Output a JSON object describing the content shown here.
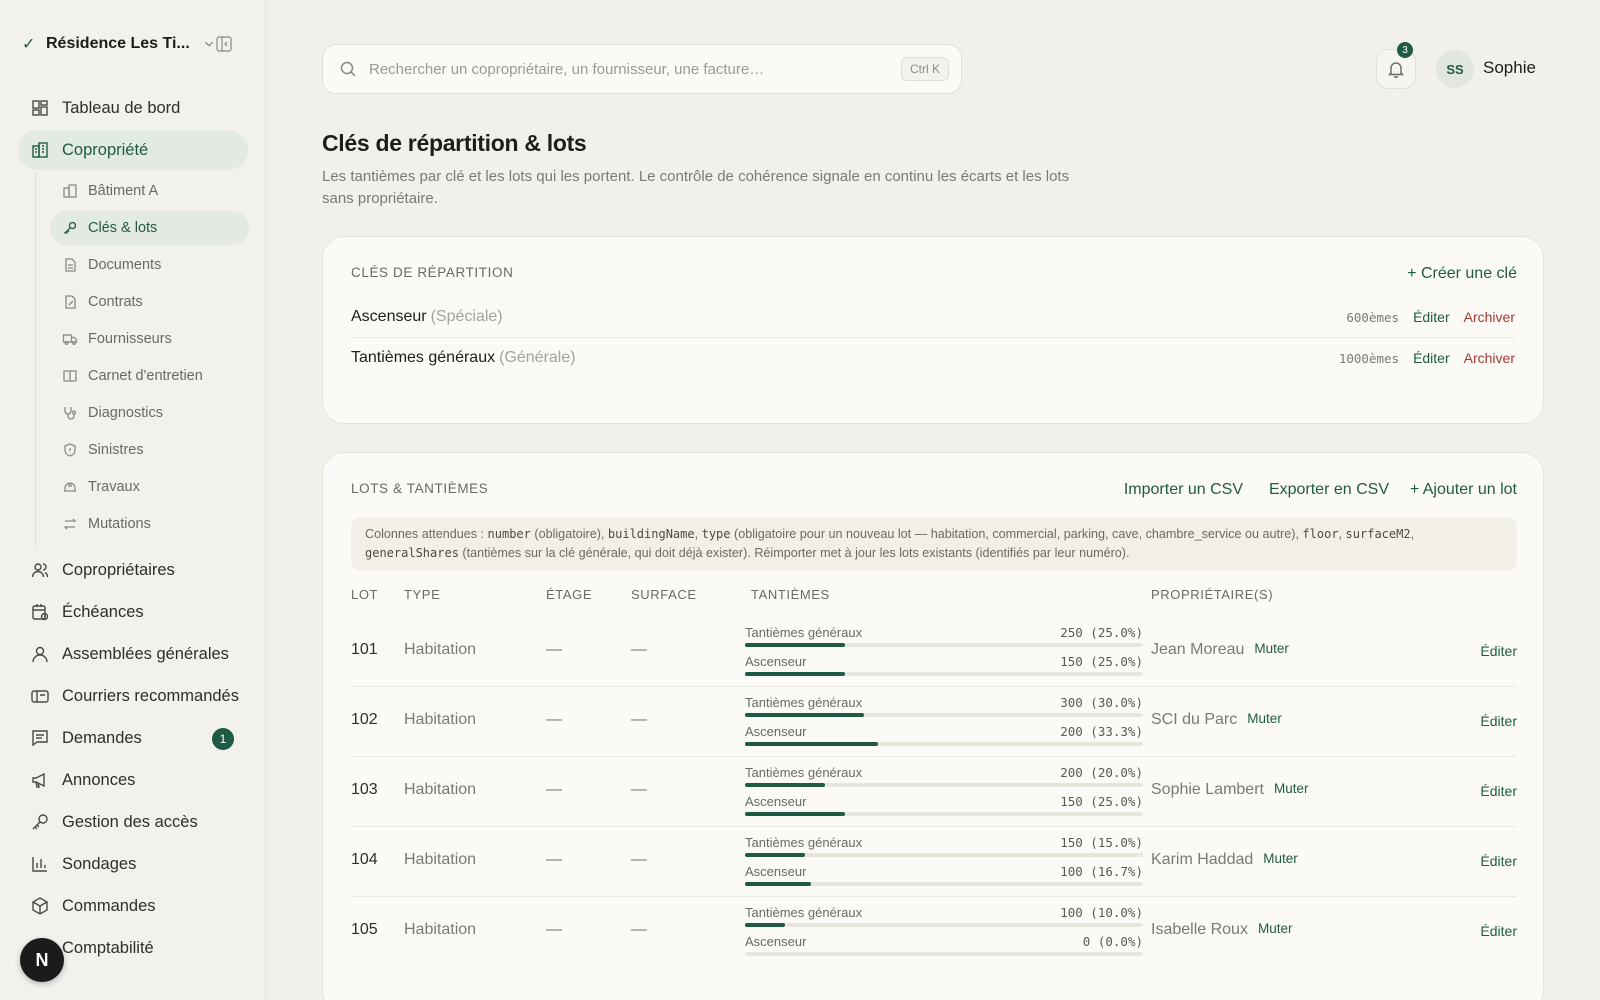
{
  "sidebar": {
    "org_name": "Résidence Les Ti...",
    "nav": [
      {
        "label": "Tableau de bord",
        "icon": "dashboard-icon"
      },
      {
        "label": "Copropriété",
        "icon": "building-icon",
        "active": true
      }
    ],
    "sub": [
      {
        "label": "Bâtiment A",
        "icon": "building-small-icon"
      },
      {
        "label": "Clés & lots",
        "icon": "key-icon",
        "active": true
      },
      {
        "label": "Documents",
        "icon": "document-icon"
      },
      {
        "label": "Contrats",
        "icon": "contract-icon"
      },
      {
        "label": "Fournisseurs",
        "icon": "truck-icon"
      },
      {
        "label": "Carnet d'entretien",
        "icon": "book-icon"
      },
      {
        "label": "Diagnostics",
        "icon": "stethoscope-icon"
      },
      {
        "label": "Sinistres",
        "icon": "shield-icon"
      },
      {
        "label": "Travaux",
        "icon": "hardhat-icon"
      },
      {
        "label": "Mutations",
        "icon": "swap-icon"
      }
    ],
    "nav2": [
      {
        "label": "Copropriétaires",
        "icon": "users-icon"
      },
      {
        "label": "Échéances",
        "icon": "calendar-clock-icon"
      },
      {
        "label": "Assemblées générales",
        "icon": "people-icon"
      },
      {
        "label": "Courriers recommandés",
        "icon": "mailbox-icon"
      },
      {
        "label": "Demandes",
        "icon": "message-icon",
        "badge": "1"
      },
      {
        "label": "Annonces",
        "icon": "megaphone-icon"
      },
      {
        "label": "Gestion des accès",
        "icon": "key-icon"
      },
      {
        "label": "Sondages",
        "icon": "bar-chart-icon"
      },
      {
        "label": "Commandes",
        "icon": "package-icon"
      },
      {
        "label": "Comptabilité",
        "icon": "ledger-icon"
      }
    ],
    "floating_badge": "N"
  },
  "topbar": {
    "search_placeholder": "Rechercher un copropriétaire, un fournisseur, une facture…",
    "shortcut": "Ctrl K",
    "notifications": "3",
    "avatar_initials": "SS",
    "user_name": "Sophie"
  },
  "header": {
    "title": "Clés de répartition & lots",
    "description": "Les tantièmes par clé et les lots qui les portent. Le contrôle de cohérence signale en continu les écarts et les lots sans propriétaire."
  },
  "keys_card": {
    "title": "Clés de répartition",
    "create_label": "+ Créer une clé",
    "edit_label": "Éditer",
    "archive_label": "Archiver",
    "keys": [
      {
        "name": "Ascenseur",
        "type": "(Spéciale)",
        "total": "600èmes"
      },
      {
        "name": "Tantièmes généraux",
        "type": "(Générale)",
        "total": "1000èmes"
      }
    ]
  },
  "lots_card": {
    "title": "Lots & tantièmes",
    "import_label": "Importer un CSV",
    "export_label": "Exporter en CSV",
    "add_label": "+ Ajouter un lot",
    "info": {
      "p1": "Colonnes attendues : ",
      "c1": "number",
      "p2": " (obligatoire), ",
      "c2": "buildingName",
      "p3": ", ",
      "c3": "type",
      "p4": " (obligatoire pour un nouveau lot — habitation, commercial, parking, cave, chambre_service ou autre), ",
      "c4": "floor",
      "p5": ", ",
      "c5": "surfaceM2",
      "p6": ", ",
      "c6": "generalShares",
      "p7": " (tantièmes sur la clé générale, qui doit déjà exister). Réimporter met à jour les lots existants (identifiés par leur numéro)."
    },
    "columns": {
      "lot": "Lot",
      "type": "Type",
      "floor": "Étage",
      "surface": "Surface",
      "shares": "Tantièmes",
      "owners": "Propriétaire(s)"
    },
    "mute_label": "Muter",
    "edit_label": "Éditer",
    "empty": "—",
    "rows": [
      {
        "lot": "101",
        "type": "Habitation",
        "owner": "Jean Moreau",
        "shares": [
          {
            "key": "Tantièmes généraux",
            "value": "250 (25.0%)",
            "pct": 25.0
          },
          {
            "key": "Ascenseur",
            "value": "150 (25.0%)",
            "pct": 25.0
          }
        ]
      },
      {
        "lot": "102",
        "type": "Habitation",
        "owner": "SCI du Parc",
        "shares": [
          {
            "key": "Tantièmes généraux",
            "value": "300 (30.0%)",
            "pct": 30.0
          },
          {
            "key": "Ascenseur",
            "value": "200 (33.3%)",
            "pct": 33.3
          }
        ]
      },
      {
        "lot": "103",
        "type": "Habitation",
        "owner": "Sophie Lambert",
        "shares": [
          {
            "key": "Tantièmes généraux",
            "value": "200 (20.0%)",
            "pct": 20.0
          },
          {
            "key": "Ascenseur",
            "value": "150 (25.0%)",
            "pct": 25.0
          }
        ]
      },
      {
        "lot": "104",
        "type": "Habitation",
        "owner": "Karim Haddad",
        "shares": [
          {
            "key": "Tantièmes généraux",
            "value": "150 (15.0%)",
            "pct": 15.0
          },
          {
            "key": "Ascenseur",
            "value": "100 (16.7%)",
            "pct": 16.7
          }
        ]
      },
      {
        "lot": "105",
        "type": "Habitation",
        "owner": "Isabelle Roux",
        "shares": [
          {
            "key": "Tantièmes généraux",
            "value": "100 (10.0%)",
            "pct": 10.0
          },
          {
            "key": "Ascenseur",
            "value": "0 (0.0%)",
            "pct": 0.0
          }
        ]
      }
    ]
  }
}
